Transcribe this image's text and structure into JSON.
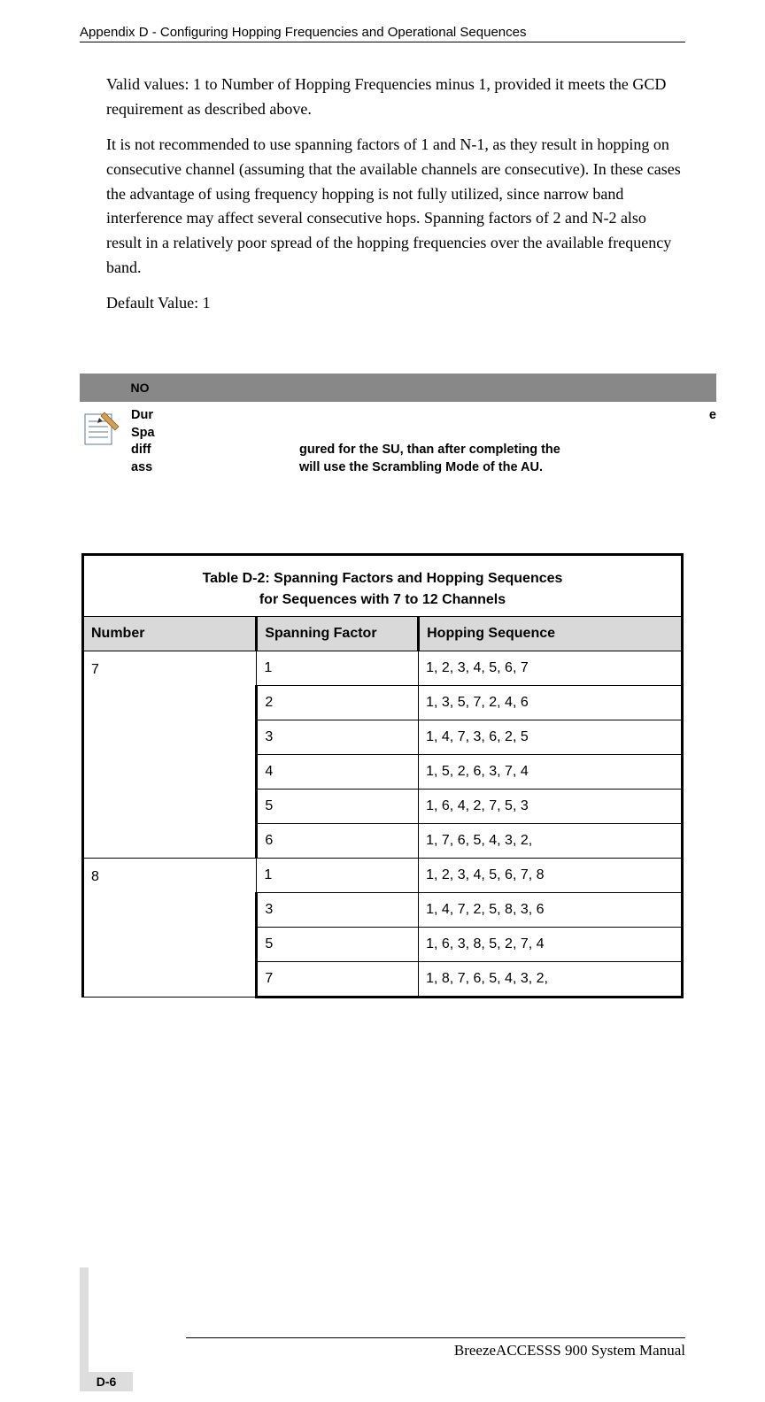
{
  "header": {
    "appendix_title": "Appendix D - Configuring Hopping Frequencies and Operational Sequences"
  },
  "body": {
    "p1": "Valid values: 1 to Number of Hopping Frequencies minus 1, provided it meets the GCD requirement as described above.",
    "p2": "It is not recommended to use spanning factors of 1 and N-1, as they result in hopping on consecutive channel (assuming that the available channels are consecutive). In these cases the advantage of using frequency hopping is not fully utilized, since narrow band interference may affect several consecutive hops. Spanning factors of 2 and N-2 also result in a relatively poor spread of the hopping frequencies over the available frequency band.",
    "p3": "Default Value: 1"
  },
  "note": {
    "label_short": "NO",
    "line1_left": "Dur",
    "line1_right": "e",
    "line2": "Spa",
    "line3_left": "diff",
    "line3_right": "gured for the SU, than after completing the",
    "line4_left": "ass",
    "line4_right": "will use the Scrambling Mode of the AU."
  },
  "table": {
    "title_line1": "Table D-2: Spanning Factors and Hopping Sequences",
    "title_line2": "for Sequences with 7 to 12 Channels",
    "col_number": "Number",
    "col_factor": "Spanning Factor",
    "col_sequence": "Hopping Sequence",
    "groups": [
      {
        "number": "7",
        "rows": [
          {
            "factor": "1",
            "seq": "1, 2, 3, 4, 5, 6, 7"
          },
          {
            "factor": "2",
            "seq": "1, 3, 5, 7, 2, 4, 6"
          },
          {
            "factor": "3",
            "seq": "1, 4, 7, 3, 6, 2, 5"
          },
          {
            "factor": "4",
            "seq": "1, 5, 2, 6, 3, 7, 4"
          },
          {
            "factor": "5",
            "seq": "1, 6, 4, 2, 7, 5, 3"
          },
          {
            "factor": "6",
            "seq": "1, 7, 6, 5, 4, 3, 2,"
          }
        ]
      },
      {
        "number": "8",
        "rows": [
          {
            "factor": "1",
            "seq": "1, 2, 3, 4, 5, 6, 7, 8"
          },
          {
            "factor": "3",
            "seq": "1, 4, 7, 2, 5, 8, 3, 6"
          },
          {
            "factor": "5",
            "seq": "1, 6, 3, 8, 5, 2, 7, 4"
          },
          {
            "factor": "7",
            "seq": "1, 8, 7, 6, 5, 4, 3, 2,"
          }
        ]
      }
    ]
  },
  "footer": {
    "manual_title": "BreezeACCESSS 900 System Manual",
    "page_number": "D-6"
  }
}
